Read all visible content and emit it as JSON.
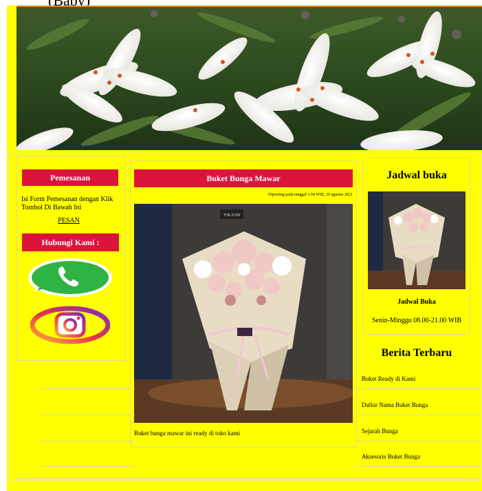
{
  "top_partial_text": "(Baby)",
  "left": {
    "order_title": "Pemesanan",
    "order_text": "Isi Form Pemesanan dengan Klik Tombol Di Bawah Ini",
    "order_link": "PESAN",
    "contact_title": "Hubungi Kami :"
  },
  "main": {
    "title": "Buket Bunga Mawar",
    "posted": "Diposting pada tanggal 1:04 WIB, 29 agustus 2021",
    "caption": "Buket bunga mawar ini ready di toko kami",
    "box_label": "THE ICON"
  },
  "right": {
    "schedule_title": "Jadwal buka",
    "schedule_sub": "Jadwal Buka",
    "schedule_hours": "Senin-Minggu 08.00-21.00 WIB",
    "news_title": "Berita Terbaru",
    "news": [
      "Buket Ready di Kami",
      "Daftar Nama Buket Bunga",
      "Sejarah Bunga",
      "Aksesoris Buket Bunga"
    ]
  },
  "colors": {
    "page_bg": "#ffff00",
    "accent": "#dc143c"
  }
}
